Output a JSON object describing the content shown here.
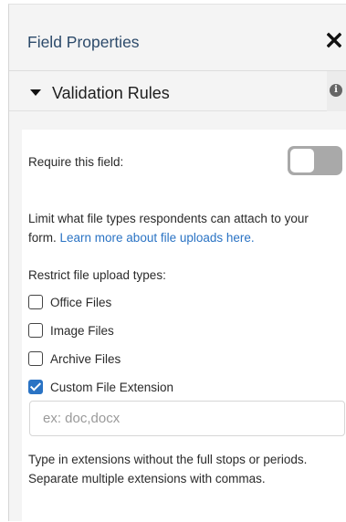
{
  "header": {
    "title": "Field Properties",
    "close_icon": "close-icon"
  },
  "section": {
    "title": "Validation Rules",
    "caret_icon": "caret-down-icon",
    "info_icon": "info-icon",
    "info_glyph": "i"
  },
  "require": {
    "label": "Require this field:",
    "toggle_on": false
  },
  "description": {
    "text": "Limit what file types respondents can attach to your form. ",
    "link": "Learn more about file uploads here."
  },
  "restrict": {
    "label": "Restrict file upload types:",
    "options": [
      {
        "label": "Office Files",
        "checked": false
      },
      {
        "label": "Image Files",
        "checked": false
      },
      {
        "label": "Archive Files",
        "checked": false
      },
      {
        "label": "Custom File Extension",
        "checked": true
      }
    ]
  },
  "extension_input": {
    "value": "",
    "placeholder": "ex: doc,docx"
  },
  "help_text": "Type in extensions without the full stops or periods. Separate multiple extensions with commas.",
  "colors": {
    "header_text": "#2c4a6a",
    "link": "#2a73c4",
    "checkbox_checked": "#2a73c4",
    "toggle_off": "#a9a9a9",
    "panel_bg": "#f4f4f4"
  }
}
